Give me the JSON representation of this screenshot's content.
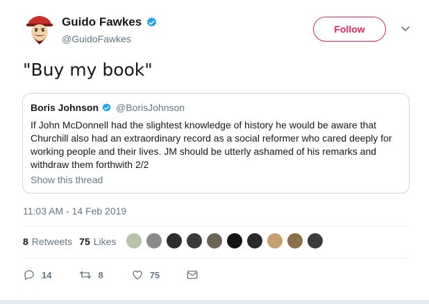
{
  "author": {
    "display_name": "Guido Fawkes",
    "handle": "@GuidoFawkes",
    "avatar_icon": "guido-mask-avatar",
    "verified_icon": "verified-badge-icon"
  },
  "follow_button": {
    "label": "Follow",
    "color": "#e0245e"
  },
  "tweet": {
    "text": "\"Buy my book\""
  },
  "quoted_tweet": {
    "display_name": "Boris Johnson",
    "handle": "@BorisJohnson",
    "text": "If John McDonnell had the slightest knowledge of history he would be aware that Churchill also had an extraordinary record as a social reformer who cared deeply for working people and their lives. JM should be utterly ashamed of his remarks and withdraw them forthwith 2/2",
    "show_thread_label": "Show this thread"
  },
  "timestamp": "11:03 AM - 14 Feb 2019",
  "stats": {
    "retweets_count": "8",
    "retweets_label": "Retweets",
    "likes_count": "75",
    "likes_label": "Likes"
  },
  "likers_avatars": [
    "#b9c2a8",
    "#8a8a8a",
    "#2d2d2d",
    "#3a3a3a",
    "#6b6355",
    "#151515",
    "#2a2a2a",
    "#c8a070",
    "#8b6f4a",
    "#3c3c3c"
  ],
  "actions": {
    "reply_count": "14",
    "retweet_count": "8",
    "like_count": "75"
  },
  "colors": {
    "link_gray": "#657786",
    "text": "#14171a",
    "verified_blue": "#1da1f2"
  }
}
